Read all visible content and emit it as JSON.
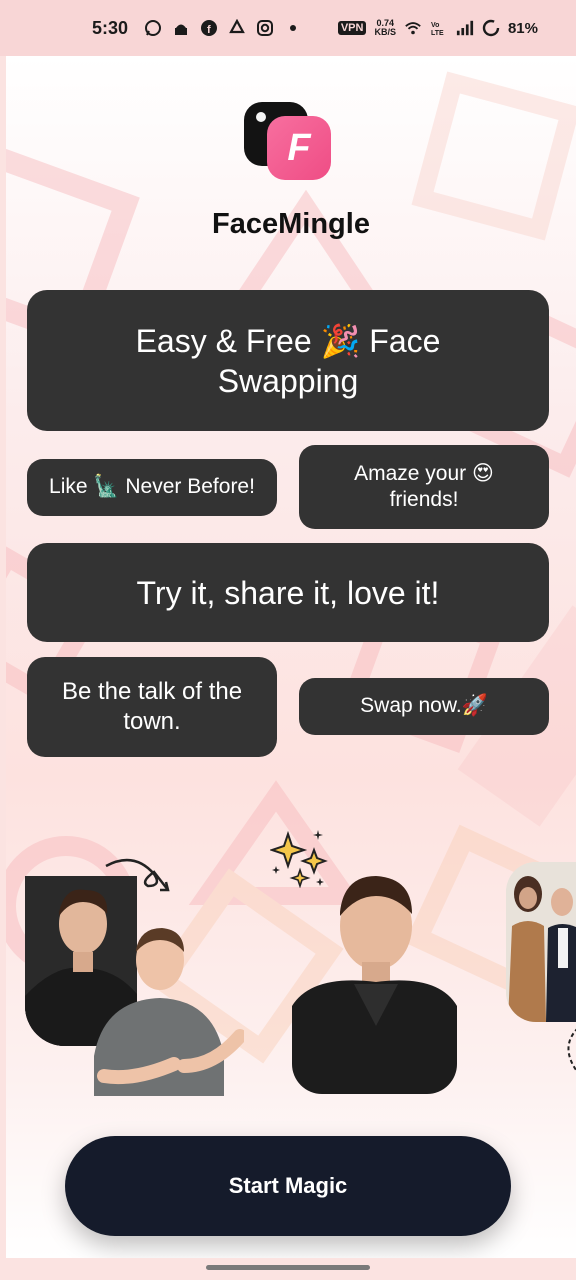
{
  "status_bar": {
    "time": "5:30",
    "left_icons": [
      "whatsapp-icon",
      "mosque-icon",
      "facebook-icon",
      "recycle-icon",
      "instagram-icon",
      "dot-icon"
    ],
    "vpn": "VPN",
    "speed_value": "0.74",
    "speed_unit": "KB/S",
    "battery": "81%"
  },
  "app": {
    "name": "FaceMingle",
    "logo_letter": "F"
  },
  "pills": {
    "p1": "Easy & Free 🎉 Face Swapping",
    "p2": "Like 🗽 Never Before!",
    "p3": "Amaze your 😍 friends!",
    "p4": "Try it, share it, love it!",
    "p5": "Be the talk of the town.",
    "p6": "Swap now.🚀"
  },
  "actions": {
    "start": "Start Magic"
  },
  "colors": {
    "pill_bg": "#333333",
    "button_bg": "#151b2b",
    "logo_pink": "#ef4d85",
    "background": "#fbe3e1"
  }
}
